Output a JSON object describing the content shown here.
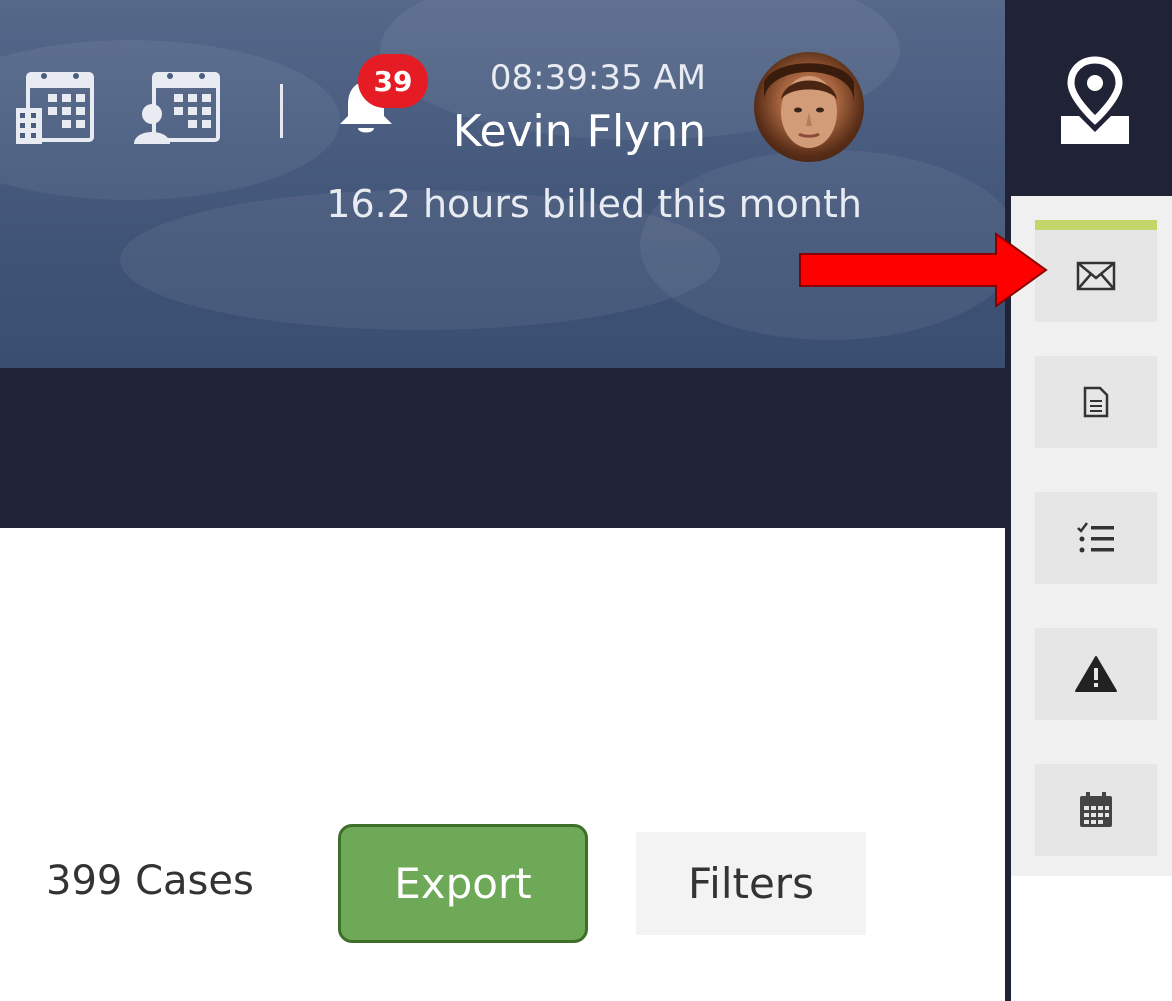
{
  "header": {
    "icons": [
      "calendar-building-icon",
      "calendar-person-icon"
    ],
    "notifications": {
      "icon": "bell-icon",
      "count": "39"
    },
    "time": "08:39:35 AM",
    "user_name": "Kevin Flynn",
    "billed_text": "16.2 hours billed this month",
    "avatar": "user-avatar"
  },
  "sidebar": {
    "logo": "map-pin-inbox-logo",
    "active_indicator_color": "#c3d66a",
    "items": [
      {
        "icon": "envelope-icon",
        "active": true
      },
      {
        "icon": "document-icon"
      },
      {
        "icon": "checklist-icon"
      },
      {
        "icon": "warning-icon"
      },
      {
        "icon": "calendar-icon"
      }
    ]
  },
  "annotation": {
    "icon": "red-arrow",
    "color": "#ff0000"
  },
  "toolbar": {
    "case_count": "399 Cases",
    "export_label": "Export",
    "filters_label": "Filters"
  },
  "colors": {
    "header_dark": "#1f2335",
    "export_green": "#6ea957",
    "badge_red": "#e51c23"
  }
}
